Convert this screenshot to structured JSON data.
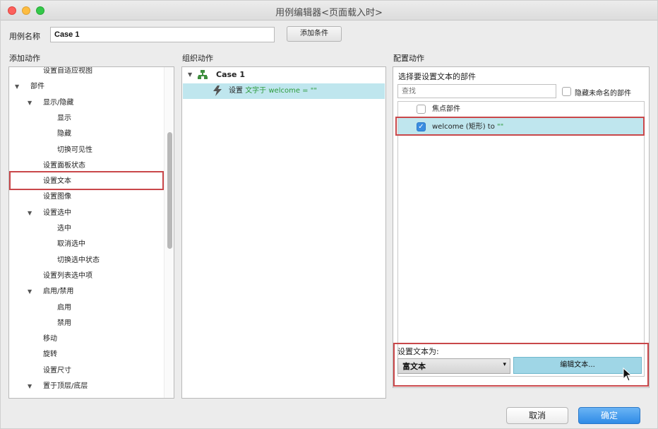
{
  "window": {
    "title": "用例编辑器<页面载入时>"
  },
  "case_row": {
    "label": "用例名称",
    "value": "Case 1",
    "add_condition_button": "添加条件"
  },
  "columns": {
    "add_action": "添加动作",
    "organize_action": "组织动作",
    "configure_action": "配置动作"
  },
  "left_tree": [
    {
      "label": "设置自适应视图",
      "arrow": ""
    },
    {
      "label": "部件",
      "arrow": "▼"
    },
    {
      "label": "显示/隐藏",
      "arrow": "▼"
    },
    {
      "label": "显示",
      "arrow": ""
    },
    {
      "label": "隐藏",
      "arrow": ""
    },
    {
      "label": "切换可见性",
      "arrow": ""
    },
    {
      "label": "设置面板状态",
      "arrow": ""
    },
    {
      "label": "设置文本",
      "arrow": ""
    },
    {
      "label": "设置图像",
      "arrow": ""
    },
    {
      "label": "设置选中",
      "arrow": "▼"
    },
    {
      "label": "选中",
      "arrow": ""
    },
    {
      "label": "取消选中",
      "arrow": ""
    },
    {
      "label": "切换选中状态",
      "arrow": ""
    },
    {
      "label": "设置列表选中项",
      "arrow": ""
    },
    {
      "label": "启用/禁用",
      "arrow": "▼"
    },
    {
      "label": "启用",
      "arrow": ""
    },
    {
      "label": "禁用",
      "arrow": ""
    },
    {
      "label": "移动",
      "arrow": ""
    },
    {
      "label": "旋转",
      "arrow": ""
    },
    {
      "label": "设置尺寸",
      "arrow": ""
    },
    {
      "label": "置于顶层/底层",
      "arrow": "▼"
    }
  ],
  "middle": {
    "case_label": "Case 1",
    "case_arrow": "▼",
    "action_prefix": "设置",
    "action_text": "文字于 welcome = \"\""
  },
  "right": {
    "section_title": "选择要设置文本的部件",
    "search_placeholder": "查找",
    "hide_unnamed_label": "隐藏未命名的部件",
    "rows": [
      {
        "label": "焦点部件",
        "checked": false
      },
      {
        "label_main": "welcome (矩形) to ",
        "label_value": "\"\"",
        "checked": true
      }
    ],
    "set_text_label": "设置文本为:",
    "text_type_value": "富文本",
    "text_type_caret": "▾",
    "edit_text_button": "编辑文本..."
  },
  "footer": {
    "cancel": "取消",
    "ok": "确定"
  },
  "colors": {
    "selection": "#bfe6ee",
    "highlight_red": "#c9474a",
    "green_text": "#2e9b3c",
    "primary_blue": "#2f8be6"
  }
}
